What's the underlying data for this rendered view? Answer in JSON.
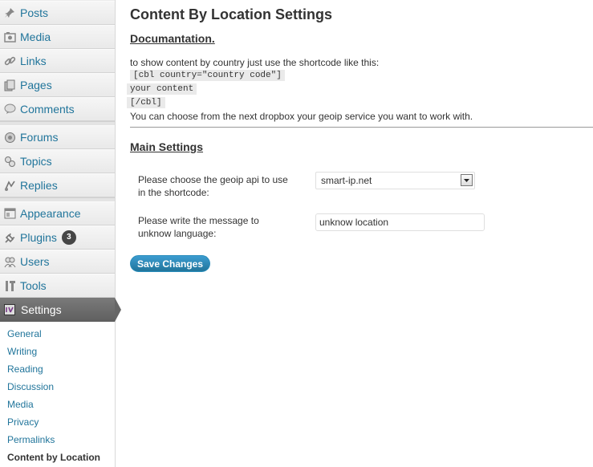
{
  "sidebar": {
    "items": [
      {
        "label": "Posts",
        "icon": "pin-icon"
      },
      {
        "label": "Media",
        "icon": "media-icon"
      },
      {
        "label": "Links",
        "icon": "link-icon"
      },
      {
        "label": "Pages",
        "icon": "pages-icon"
      },
      {
        "label": "Comments",
        "icon": "comment-icon"
      },
      {
        "label": "Forums",
        "icon": "forums-icon"
      },
      {
        "label": "Topics",
        "icon": "topics-icon"
      },
      {
        "label": "Replies",
        "icon": "replies-icon"
      },
      {
        "label": "Appearance",
        "icon": "appearance-icon"
      },
      {
        "label": "Plugins",
        "icon": "plug-icon",
        "badge": "3"
      },
      {
        "label": "Users",
        "icon": "users-icon"
      },
      {
        "label": "Tools",
        "icon": "tools-icon"
      }
    ],
    "settings": {
      "label": "Settings",
      "icon": "settings-icon"
    },
    "submenu": [
      "General",
      "Writing",
      "Reading",
      "Discussion",
      "Media",
      "Privacy",
      "Permalinks",
      "Content by Location"
    ],
    "current_submenu": "Content by Location"
  },
  "main": {
    "title": "Content By Location Settings",
    "doc_heading": "Documantation.",
    "doc_intro": "to show content by country just use the shortcode like this:",
    "code_line1": "[cbl country=\"country code\"]",
    "code_line2": "your content",
    "code_line3": "[/cbl]",
    "doc_outro": "You can choose from the next dropbox your geoip service you want to work with.",
    "settings_heading": "Main Settings",
    "geoip_label_line1": "Please choose the geoip api to use",
    "geoip_label_line2": "in the shortcode:",
    "geoip_selected": "smart-ip.net",
    "message_label_line1": "Please write the message to",
    "message_label_line2": "unknow language:",
    "message_value": "unknow location",
    "save_label": "Save Changes"
  },
  "colors": {
    "link": "#21759b",
    "button": "#21759b",
    "settings_active": "#6d6d6d"
  }
}
